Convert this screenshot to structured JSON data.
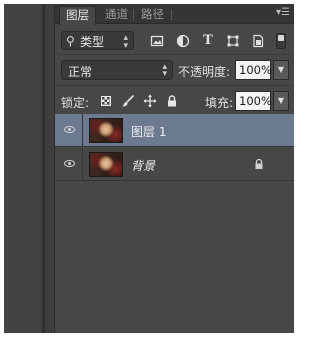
{
  "tabs": [
    {
      "label": "图层",
      "active": true
    },
    {
      "label": "通道",
      "active": false
    },
    {
      "label": "路径",
      "active": false
    }
  ],
  "panel_menu_icon": "panel-menu-icon",
  "filter": {
    "kind_label": "类型",
    "icons": [
      "image-filter-icon",
      "adjustment-filter-icon",
      "type-filter-icon",
      "shape-filter-icon",
      "smart-object-filter-icon"
    ]
  },
  "blend": {
    "mode": "正常",
    "opacity_label": "不透明度:",
    "opacity_value": "100%"
  },
  "lock": {
    "label": "锁定:",
    "icons": [
      "lock-transparency-icon",
      "lock-pixels-icon",
      "lock-position-icon",
      "lock-all-icon"
    ],
    "fill_label": "填充:",
    "fill_value": "100%"
  },
  "layers": [
    {
      "name": "图层 1",
      "visible": true,
      "selected": true,
      "locked": false
    },
    {
      "name": "背景",
      "visible": true,
      "selected": false,
      "locked": true
    }
  ],
  "colors": {
    "panel_bg": "#474747",
    "tabbar_bg": "#353535",
    "selected_layer": "#6b7a8f",
    "field_bg": "#f4f4f4"
  }
}
